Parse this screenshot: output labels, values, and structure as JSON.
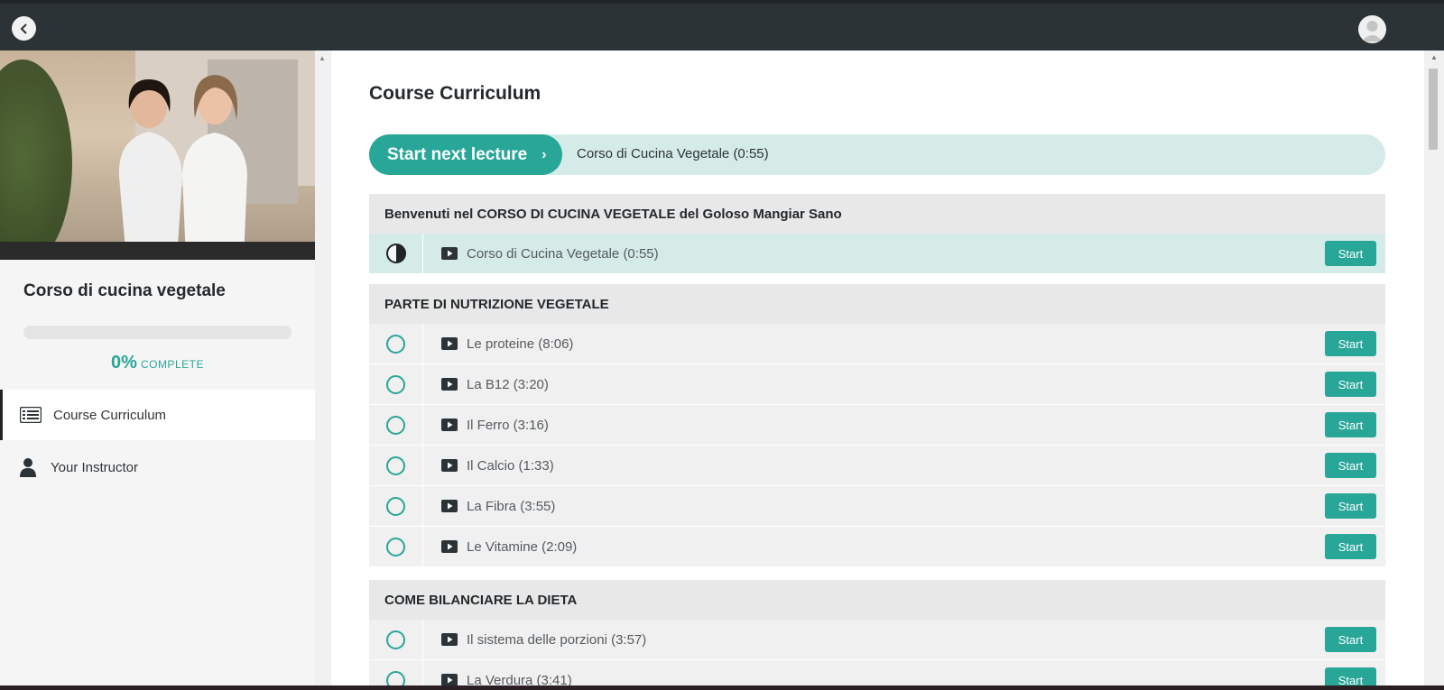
{
  "course": {
    "title": "Corso di cucina vegetale",
    "progress_percent": "0%",
    "progress_fraction": 0,
    "progress_label": "COMPLETE"
  },
  "sidebar": {
    "items": [
      {
        "label": "Course Curriculum",
        "icon": "curriculum-list-icon",
        "active": true
      },
      {
        "label": "Your Instructor",
        "icon": "user-icon",
        "active": false
      }
    ]
  },
  "main": {
    "title": "Course Curriculum",
    "next": {
      "button_label": "Start next lecture",
      "chevron": "›",
      "lecture": "Corso di Cucina Vegetale (0:55)"
    },
    "start_label": "Start",
    "sections": [
      {
        "title": "Benvenuti nel CORSO DI CUCINA VEGETALE del Goloso Mangiar Sano",
        "lectures": [
          {
            "title": "Corso di Cucina Vegetale (0:55)",
            "status": "in-progress"
          }
        ]
      },
      {
        "title": "PARTE DI NUTRIZIONE VEGETALE",
        "lectures": [
          {
            "title": "Le proteine (8:06)",
            "status": "not-started"
          },
          {
            "title": "La B12 (3:20)",
            "status": "not-started"
          },
          {
            "title": "Il Ferro (3:16)",
            "status": "not-started"
          },
          {
            "title": "Il Calcio (1:33)",
            "status": "not-started"
          },
          {
            "title": "La Fibra (3:55)",
            "status": "not-started"
          },
          {
            "title": "Le Vitamine (2:09)",
            "status": "not-started"
          }
        ]
      },
      {
        "title": "COME BILANCIARE LA DIETA",
        "lectures": [
          {
            "title": "Il sistema delle porzioni (3:57)",
            "status": "not-started"
          },
          {
            "title": "La Verdura (3:41)",
            "status": "not-started"
          }
        ]
      }
    ]
  },
  "colors": {
    "accent": "#28a698",
    "topbar": "#2c3336",
    "highlight_row": "#d5ebe8"
  }
}
